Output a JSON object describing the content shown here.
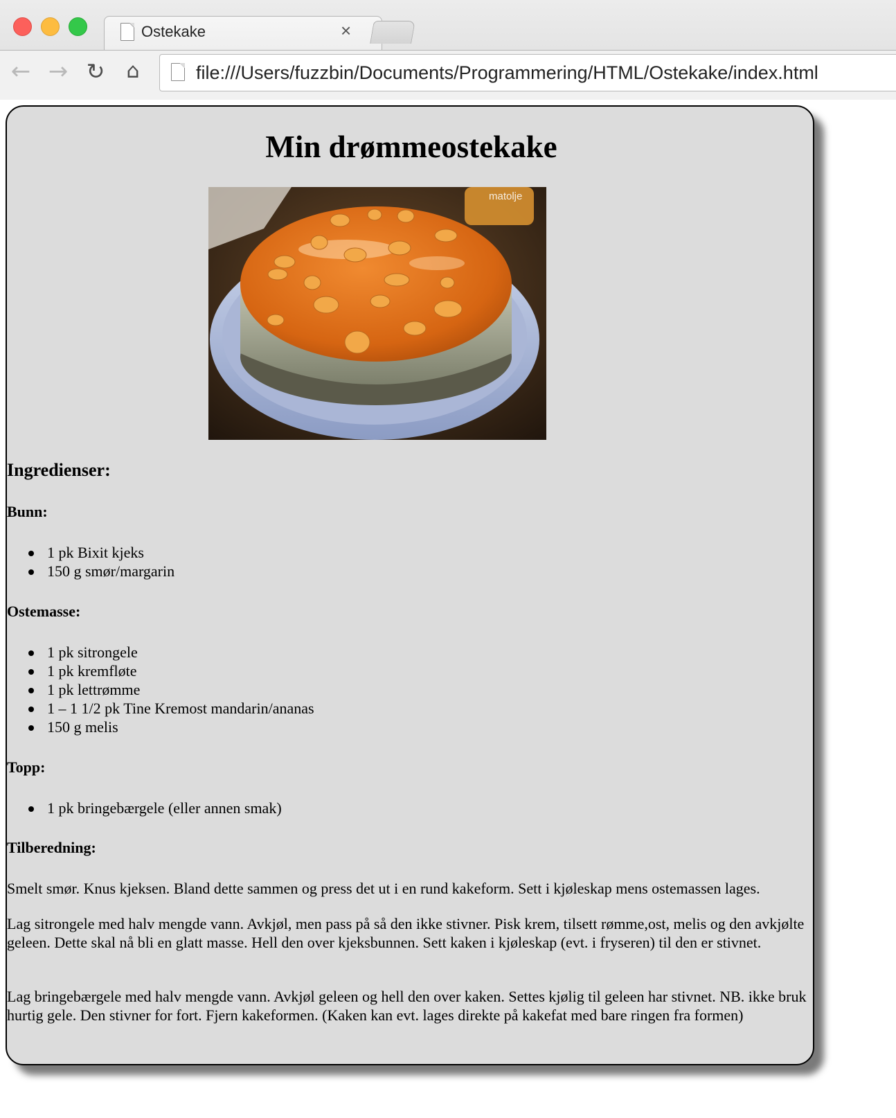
{
  "browser": {
    "tab_title": "Ostekake",
    "tab_close": "×",
    "url": "file:///Users/fuzzbin/Documents/Programmering/HTML/Ostekake/index.html",
    "icons": [
      "back-arrow-icon",
      "forward-arrow-icon",
      "reload-icon",
      "home-icon",
      "document-icon",
      "close-icon"
    ]
  },
  "page": {
    "title": "Min drømmeostekake",
    "image_label": "matolje",
    "ingredients_heading": "Ingredienser:",
    "sections": [
      {
        "heading": "Bunn:",
        "items": [
          "1 pk Bixit kjeks",
          "150 g smør/margarin"
        ]
      },
      {
        "heading": "Ostemasse:",
        "items": [
          "1 pk sitrongele",
          "1 pk kremfløte",
          "1 pk lettrømme",
          "1 – 1 1/2 pk Tine Kremost mandarin/ananas",
          "150 g melis"
        ]
      },
      {
        "heading": "Topp:",
        "items": [
          "1 pk bringebærgele (eller annen smak)"
        ]
      }
    ],
    "preparation_heading": "Tilberedning:",
    "paragraphs": [
      "Smelt smør. Knus kjeksen. Bland dette sammen og press det ut i en rund kakeform. Sett i kjøleskap mens ostemassen lages.",
      "Lag sitrongele med halv mengde vann. Avkjøl, men pass på så den ikke stivner. Pisk krem, tilsett rømme,ost, melis og den avkjølte geleen. Dette skal nå bli en glatt masse. Hell den over kjeksbunnen. Sett kaken i kjøleskap (evt. i fryseren) til den er stivnet.",
      "Lag bringebærgele med halv mengde vann. Avkjøl geleen og hell den over kaken. Settes kjølig til geleen har stivnet. NB. ikke bruk hurtig gele. Den stivner for fort. Fjern kakeformen. (Kaken kan evt. lages direkte på kakefat med bare ringen fra formen)"
    ]
  }
}
